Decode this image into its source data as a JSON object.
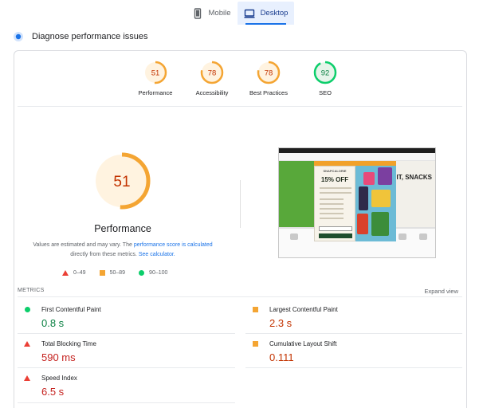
{
  "tabs": [
    {
      "label": "Mobile",
      "icon": "phone-icon",
      "active": false
    },
    {
      "label": "Desktop",
      "icon": "desktop-icon",
      "active": true
    }
  ],
  "section_title": "Diagnose performance issues",
  "colors": {
    "good": "#0cce6b",
    "average": "#f4a533",
    "poor": "#eb3f35",
    "link": "#1a73e8"
  },
  "categories": [
    {
      "label": "Performance",
      "score": "51",
      "rating": "average"
    },
    {
      "label": "Accessibility",
      "score": "78",
      "rating": "average"
    },
    {
      "label": "Best Practices",
      "score": "78",
      "rating": "average"
    },
    {
      "label": "SEO",
      "score": "92",
      "rating": "good"
    }
  ],
  "main_score": {
    "value": "51",
    "fraction": 0.51,
    "label": "Performance"
  },
  "note": {
    "prefix": "Values are estimated and may vary. The ",
    "link1": "performance score is calculated",
    "middle": " directly from these metrics. ",
    "link2": "See calculator."
  },
  "legend": [
    {
      "range": "0–49",
      "shape": "triangle",
      "rating": "poor"
    },
    {
      "range": "50–89",
      "shape": "square",
      "rating": "average"
    },
    {
      "range": "90–100",
      "shape": "circle",
      "rating": "good"
    }
  ],
  "screenshot": {
    "modal_brand": "SNAPCALORIE",
    "modal_offer": "15% OFF",
    "hero_text": "FRUIT, SNACKS"
  },
  "metrics_section": {
    "title": "METRICS",
    "expand": "Expand view"
  },
  "metrics": [
    {
      "name": "First Contentful Paint",
      "value": "0.8 s",
      "rating": "good"
    },
    {
      "name": "Largest Contentful Paint",
      "value": "2.3 s",
      "rating": "average"
    },
    {
      "name": "Total Blocking Time",
      "value": "590 ms",
      "rating": "poor"
    },
    {
      "name": "Cumulative Layout Shift",
      "value": "0.111",
      "rating": "average"
    },
    {
      "name": "Speed Index",
      "value": "6.5 s",
      "rating": "poor"
    }
  ]
}
